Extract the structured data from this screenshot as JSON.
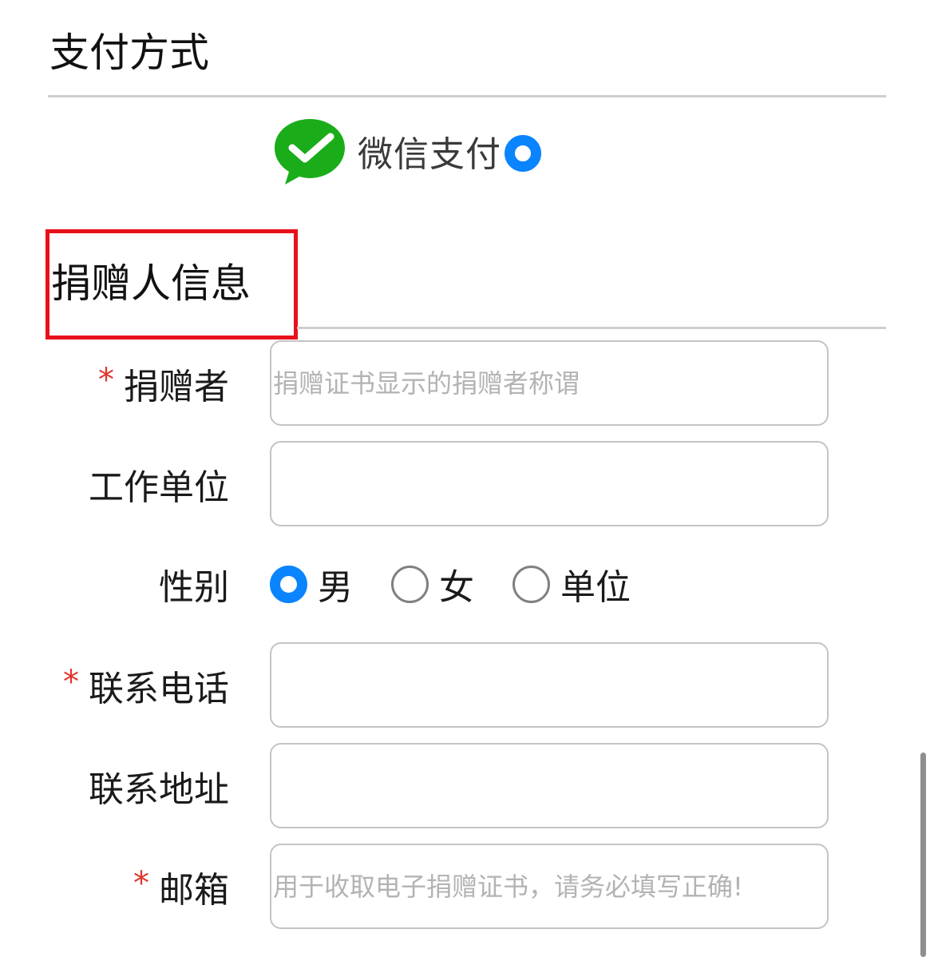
{
  "payment": {
    "title": "支付方式",
    "options": [
      {
        "label": "微信支付",
        "icon": "wechat-pay-icon",
        "selected": true
      }
    ]
  },
  "donor": {
    "title": "捐赠人信息",
    "fields": {
      "name": {
        "label": "捐赠者",
        "required": true,
        "placeholder": "捐赠证书显示的捐赠者称谓",
        "value": ""
      },
      "workplace": {
        "label": "工作单位",
        "required": false,
        "placeholder": "",
        "value": ""
      },
      "gender": {
        "label": "性别",
        "options": [
          "男",
          "女",
          "单位"
        ],
        "selected": "男"
      },
      "phone": {
        "label": "联系电话",
        "required": true,
        "placeholder": "",
        "value": ""
      },
      "address": {
        "label": "联系地址",
        "required": false,
        "placeholder": "",
        "value": ""
      },
      "email": {
        "label": "邮箱",
        "required": true,
        "placeholder": "用于收取电子捐赠证书，请务必填写正确!",
        "value": ""
      }
    },
    "required_mark": "*"
  },
  "colors": {
    "accent": "#0a84ff",
    "required": "#e0352b",
    "highlight_box": "#e8101a",
    "wechat_green": "#1aad19"
  }
}
